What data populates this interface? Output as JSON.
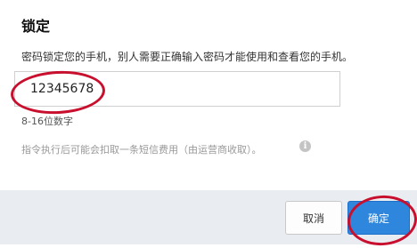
{
  "dialog": {
    "title": "锁定",
    "description": "密码锁定您的手机，别人需要正确输入密码才能使用和查看您的手机。",
    "password_value": "12345678",
    "length_hint": "8-16位数字",
    "fee_note": "指令执行后可能会扣取一条短信费用（由运营商收取）。",
    "info_icon": "i"
  },
  "footer": {
    "cancel_label": "取消",
    "confirm_label": "确定"
  },
  "colors": {
    "footer_bg": "#e9edf2",
    "confirm_bg": "#2f86dd",
    "annotation": "#c8102e"
  }
}
